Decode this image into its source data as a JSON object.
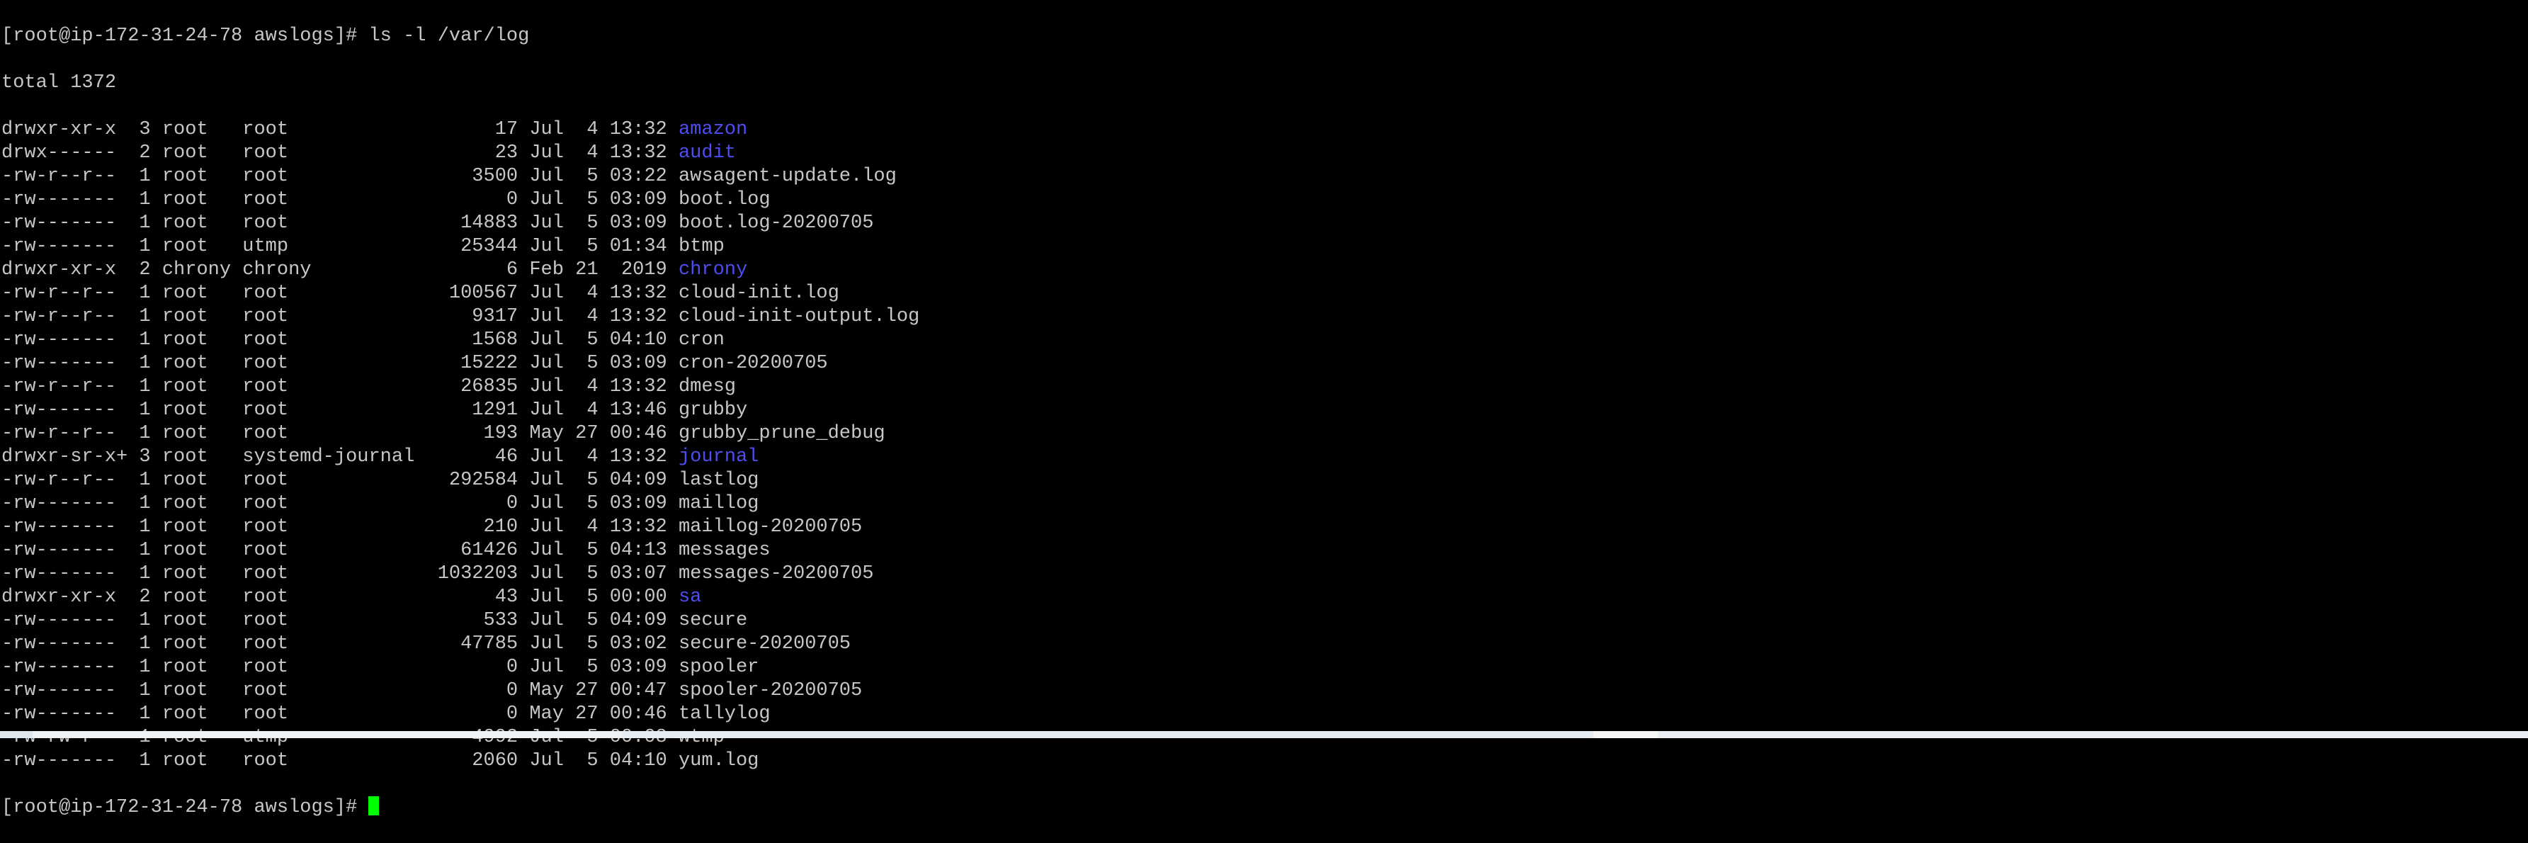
{
  "terminal": {
    "command_line": "[root@ip-172-31-24-78 awslogs]# ls -l /var/log",
    "total_line": "total 1372",
    "rows": [
      {
        "meta": "drwxr-xr-x  3 root   root                  17 Jul  4 13:32 ",
        "name": "amazon",
        "is_dir": true
      },
      {
        "meta": "drwx------  2 root   root                  23 Jul  4 13:32 ",
        "name": "audit",
        "is_dir": true
      },
      {
        "meta": "-rw-r--r--  1 root   root                3500 Jul  5 03:22 ",
        "name": "awsagent-update.log",
        "is_dir": false
      },
      {
        "meta": "-rw-------  1 root   root                   0 Jul  5 03:09 ",
        "name": "boot.log",
        "is_dir": false
      },
      {
        "meta": "-rw-------  1 root   root               14883 Jul  5 03:09 ",
        "name": "boot.log-20200705",
        "is_dir": false
      },
      {
        "meta": "-rw-------  1 root   utmp               25344 Jul  5 01:34 ",
        "name": "btmp",
        "is_dir": false
      },
      {
        "meta": "drwxr-xr-x  2 chrony chrony                 6 Feb 21  2019 ",
        "name": "chrony",
        "is_dir": true
      },
      {
        "meta": "-rw-r--r--  1 root   root              100567 Jul  4 13:32 ",
        "name": "cloud-init.log",
        "is_dir": false
      },
      {
        "meta": "-rw-r--r--  1 root   root                9317 Jul  4 13:32 ",
        "name": "cloud-init-output.log",
        "is_dir": false
      },
      {
        "meta": "-rw-------  1 root   root                1568 Jul  5 04:10 ",
        "name": "cron",
        "is_dir": false
      },
      {
        "meta": "-rw-------  1 root   root               15222 Jul  5 03:09 ",
        "name": "cron-20200705",
        "is_dir": false
      },
      {
        "meta": "-rw-r--r--  1 root   root               26835 Jul  4 13:32 ",
        "name": "dmesg",
        "is_dir": false
      },
      {
        "meta": "-rw-------  1 root   root                1291 Jul  4 13:46 ",
        "name": "grubby",
        "is_dir": false
      },
      {
        "meta": "-rw-r--r--  1 root   root                 193 May 27 00:46 ",
        "name": "grubby_prune_debug",
        "is_dir": false
      },
      {
        "meta": "drwxr-sr-x+ 3 root   systemd-journal       46 Jul  4 13:32 ",
        "name": "journal",
        "is_dir": true
      },
      {
        "meta": "-rw-r--r--  1 root   root              292584 Jul  5 04:09 ",
        "name": "lastlog",
        "is_dir": false
      },
      {
        "meta": "-rw-------  1 root   root                   0 Jul  5 03:09 ",
        "name": "maillog",
        "is_dir": false
      },
      {
        "meta": "-rw-------  1 root   root                 210 Jul  4 13:32 ",
        "name": "maillog-20200705",
        "is_dir": false
      },
      {
        "meta": "-rw-------  1 root   root               61426 Jul  5 04:13 ",
        "name": "messages",
        "is_dir": false
      },
      {
        "meta": "-rw-------  1 root   root             1032203 Jul  5 03:07 ",
        "name": "messages-20200705",
        "is_dir": false
      },
      {
        "meta": "drwxr-xr-x  2 root   root                  43 Jul  5 00:00 ",
        "name": "sa",
        "is_dir": true
      },
      {
        "meta": "-rw-------  1 root   root                 533 Jul  5 04:09 ",
        "name": "secure",
        "is_dir": false
      },
      {
        "meta": "-rw-------  1 root   root               47785 Jul  5 03:02 ",
        "name": "secure-20200705",
        "is_dir": false
      },
      {
        "meta": "-rw-------  1 root   root                   0 Jul  5 03:09 ",
        "name": "spooler",
        "is_dir": false
      },
      {
        "meta": "-rw-------  1 root   root                   0 May 27 00:47 ",
        "name": "spooler-20200705",
        "is_dir": false
      },
      {
        "meta": "-rw-------  1 root   root                   0 May 27 00:46 ",
        "name": "tallylog",
        "is_dir": false
      },
      {
        "meta": "-rw-rw-r--  1 root   utmp                4992 Jul  5 00:08 ",
        "name": "wtmp",
        "is_dir": false
      },
      {
        "meta": "-rw-------  1 root   root                2060 Jul  5 04:10 ",
        "name": "yum.log",
        "is_dir": false
      }
    ],
    "prompt": "[root@ip-172-31-24-78 awslogs]# ",
    "colors": {
      "background": "#000000",
      "text": "#c7c7c7",
      "directory": "#4d4df0",
      "cursor": "#00ff00"
    }
  }
}
